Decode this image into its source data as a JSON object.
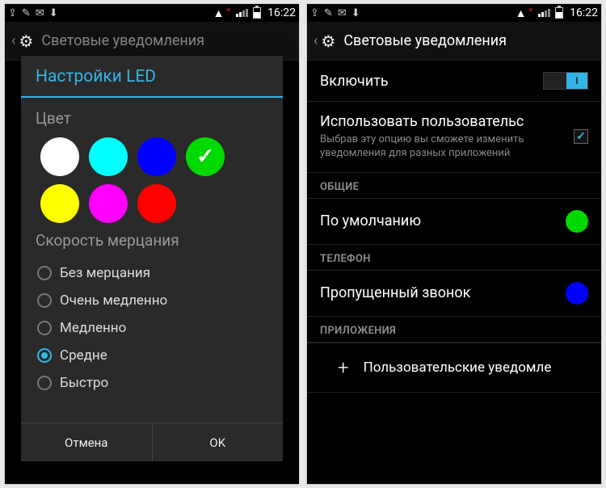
{
  "status": {
    "time": "16:22"
  },
  "screen_title": "Световые уведомления",
  "left": {
    "dialog_title": "Настройки LED",
    "section_color": "Цвет",
    "section_speed": "Скорость мерцания",
    "colors": [
      {
        "name": "white",
        "hex": "#ffffff",
        "selected": false
      },
      {
        "name": "cyan",
        "hex": "#00ffff",
        "selected": false
      },
      {
        "name": "blue",
        "hex": "#0000ff",
        "selected": false
      },
      {
        "name": "green",
        "hex": "#00d900",
        "selected": true
      },
      {
        "name": "yellow",
        "hex": "#ffff00",
        "selected": false
      },
      {
        "name": "magenta",
        "hex": "#ff00ff",
        "selected": false
      },
      {
        "name": "red",
        "hex": "#ff0000",
        "selected": false
      }
    ],
    "speeds": [
      {
        "label": "Без мерцания",
        "selected": false
      },
      {
        "label": "Очень медленно",
        "selected": false
      },
      {
        "label": "Медленно",
        "selected": false
      },
      {
        "label": "Средне",
        "selected": true
      },
      {
        "label": "Быстро",
        "selected": false
      }
    ],
    "cancel": "Отмена",
    "ok": "OK"
  },
  "right": {
    "enable": {
      "label": "Включить",
      "value": "I"
    },
    "custom": {
      "label": "Использовать пользовательс",
      "desc": "Выбрав эту опцию вы сможете изменить уведомления для разных приложений",
      "checked": true
    },
    "cat_general": "ОБЩИЕ",
    "default": {
      "label": "По умолчанию",
      "color": "#00d900"
    },
    "cat_phone": "ТЕЛЕФОН",
    "missed": {
      "label": "Пропущенный звонок",
      "color": "#0000ff"
    },
    "cat_apps": "ПРИЛОЖЕНИЯ",
    "add_label": "Пользовательские уведомле"
  }
}
